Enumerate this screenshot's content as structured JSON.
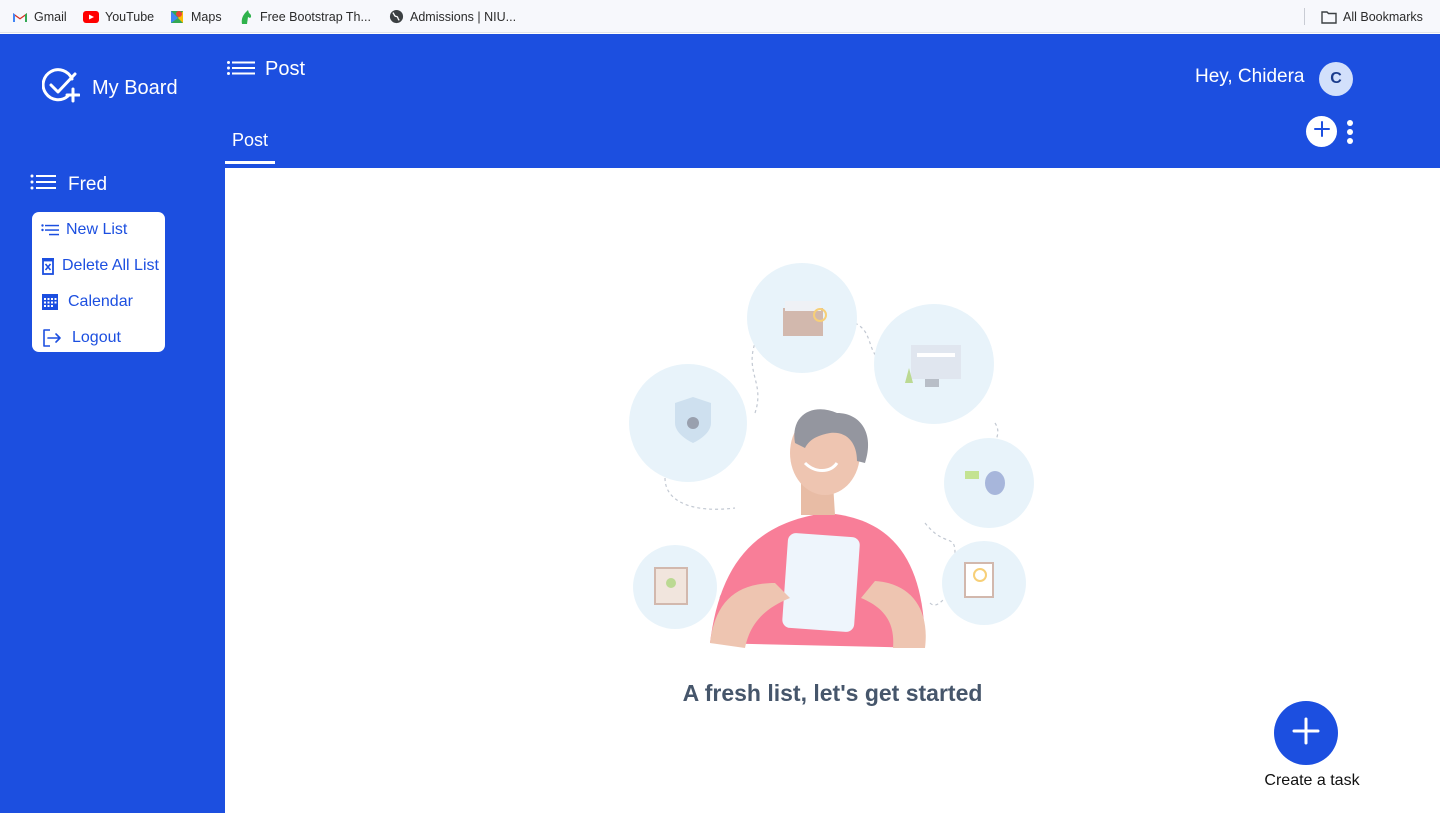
{
  "bookmarks": [
    {
      "label": "Gmail",
      "icon": "gmail-icon"
    },
    {
      "label": "YouTube",
      "icon": "youtube-icon"
    },
    {
      "label": "Maps",
      "icon": "maps-icon"
    },
    {
      "label": "Free Bootstrap Th...",
      "icon": "bootstrap-horse-icon"
    },
    {
      "label": "Admissions | NIU...",
      "icon": "globe-icon"
    }
  ],
  "bookmarks_all": {
    "label": "All Bookmarks",
    "icon": "folder-icon"
  },
  "sidebar": {
    "brand": "My Board",
    "user_section": "Fred",
    "menu": [
      {
        "label": "New List",
        "icon": "list-add-icon"
      },
      {
        "label": "Delete All List",
        "icon": "trash-icon"
      },
      {
        "label": "Calendar",
        "icon": "calendar-icon"
      },
      {
        "label": "Logout",
        "icon": "logout-icon"
      }
    ]
  },
  "header": {
    "title": "Post",
    "greeting": "Hey, Chidera",
    "avatar_initial": "C",
    "tabs": [
      {
        "label": "Post",
        "active": true
      }
    ]
  },
  "main": {
    "empty_message": "A fresh list, let's get started",
    "fab_label": "Create a task"
  },
  "colors": {
    "primary": "#1c4fe0",
    "text_muted": "#46566b",
    "illustration_shirt": "#f0778f"
  }
}
